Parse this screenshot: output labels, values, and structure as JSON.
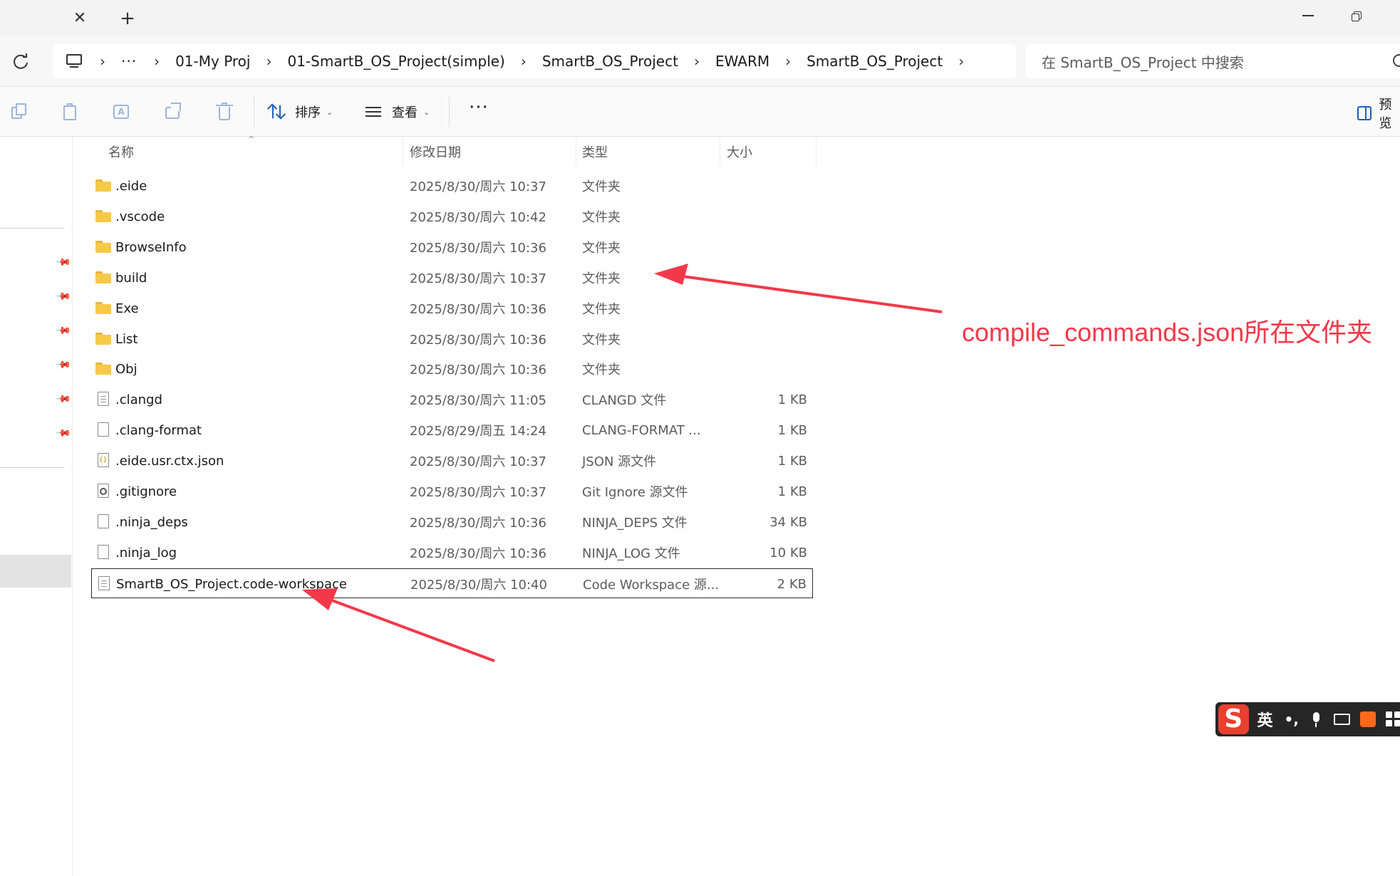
{
  "window": {
    "tab_close_glyph": "✕",
    "tab_add_glyph": "+"
  },
  "address": {
    "crumbs": [
      "01-My Proj",
      "01-SmartB_OS_Project(simple)",
      "SmartB_OS_Project",
      "EWARM",
      "SmartB_OS_Project"
    ],
    "overflow": "···",
    "separator": "›",
    "search_placeholder": "在 SmartB_OS_Project 中搜索"
  },
  "toolbar": {
    "sort_label": "排序",
    "view_label": "查看",
    "more_glyph": "···",
    "preview_label": "预览",
    "chevron": "⌄",
    "rename_glyph": "A"
  },
  "columns": {
    "name": "名称",
    "date": "修改日期",
    "type": "类型",
    "size": "大小",
    "sort_caret": "^"
  },
  "files": [
    {
      "name": ".eide",
      "date": "2025/8/30/周六 10:37",
      "type": "文件夹",
      "size": "",
      "icon": "folder-icon"
    },
    {
      "name": ".vscode",
      "date": "2025/8/30/周六 10:42",
      "type": "文件夹",
      "size": "",
      "icon": "folder-icon"
    },
    {
      "name": "BrowseInfo",
      "date": "2025/8/30/周六 10:36",
      "type": "文件夹",
      "size": "",
      "icon": "folder-icon"
    },
    {
      "name": "build",
      "date": "2025/8/30/周六 10:37",
      "type": "文件夹",
      "size": "",
      "icon": "folder-icon"
    },
    {
      "name": "Exe",
      "date": "2025/8/30/周六 10:36",
      "type": "文件夹",
      "size": "",
      "icon": "folder-icon"
    },
    {
      "name": "List",
      "date": "2025/8/30/周六 10:36",
      "type": "文件夹",
      "size": "",
      "icon": "folder-icon"
    },
    {
      "name": "Obj",
      "date": "2025/8/30/周六 10:36",
      "type": "文件夹",
      "size": "",
      "icon": "folder-icon"
    },
    {
      "name": ".clangd",
      "date": "2025/8/30/周六 11:05",
      "type": "CLANGD 文件",
      "size": "1 KB",
      "icon": "text-file-icon"
    },
    {
      "name": ".clang-format",
      "date": "2025/8/29/周五 14:24",
      "type": "CLANG-FORMAT ...",
      "size": "1 KB",
      "icon": "blank-file-icon"
    },
    {
      "name": ".eide.usr.ctx.json",
      "date": "2025/8/30/周六 10:37",
      "type": "JSON 源文件",
      "size": "1 KB",
      "icon": "json-file-icon"
    },
    {
      "name": ".gitignore",
      "date": "2025/8/30/周六 10:37",
      "type": "Git Ignore 源文件",
      "size": "1 KB",
      "icon": "config-file-icon"
    },
    {
      "name": ".ninja_deps",
      "date": "2025/8/30/周六 10:36",
      "type": "NINJA_DEPS 文件",
      "size": "34 KB",
      "icon": "blank-file-icon"
    },
    {
      "name": ".ninja_log",
      "date": "2025/8/30/周六 10:36",
      "type": "NINJA_LOG 文件",
      "size": "10 KB",
      "icon": "blank-file-icon"
    },
    {
      "name": "SmartB_OS_Project.code-workspace",
      "date": "2025/8/30/周六 10:40",
      "type": "Code Workspace 源...",
      "size": "2 KB",
      "icon": "text-file-icon"
    }
  ],
  "selected_index": 13,
  "annotation": {
    "text": "compile_commands.json所在文件夹",
    "color": "#f2394a"
  },
  "ime": {
    "logo": "S",
    "lang": "英",
    "punct": "•,"
  },
  "colors": {
    "accent": "#1f5fb4",
    "folder": "#f7c948",
    "annotation": "#f2394a",
    "ime_logo": "#e8402e"
  }
}
